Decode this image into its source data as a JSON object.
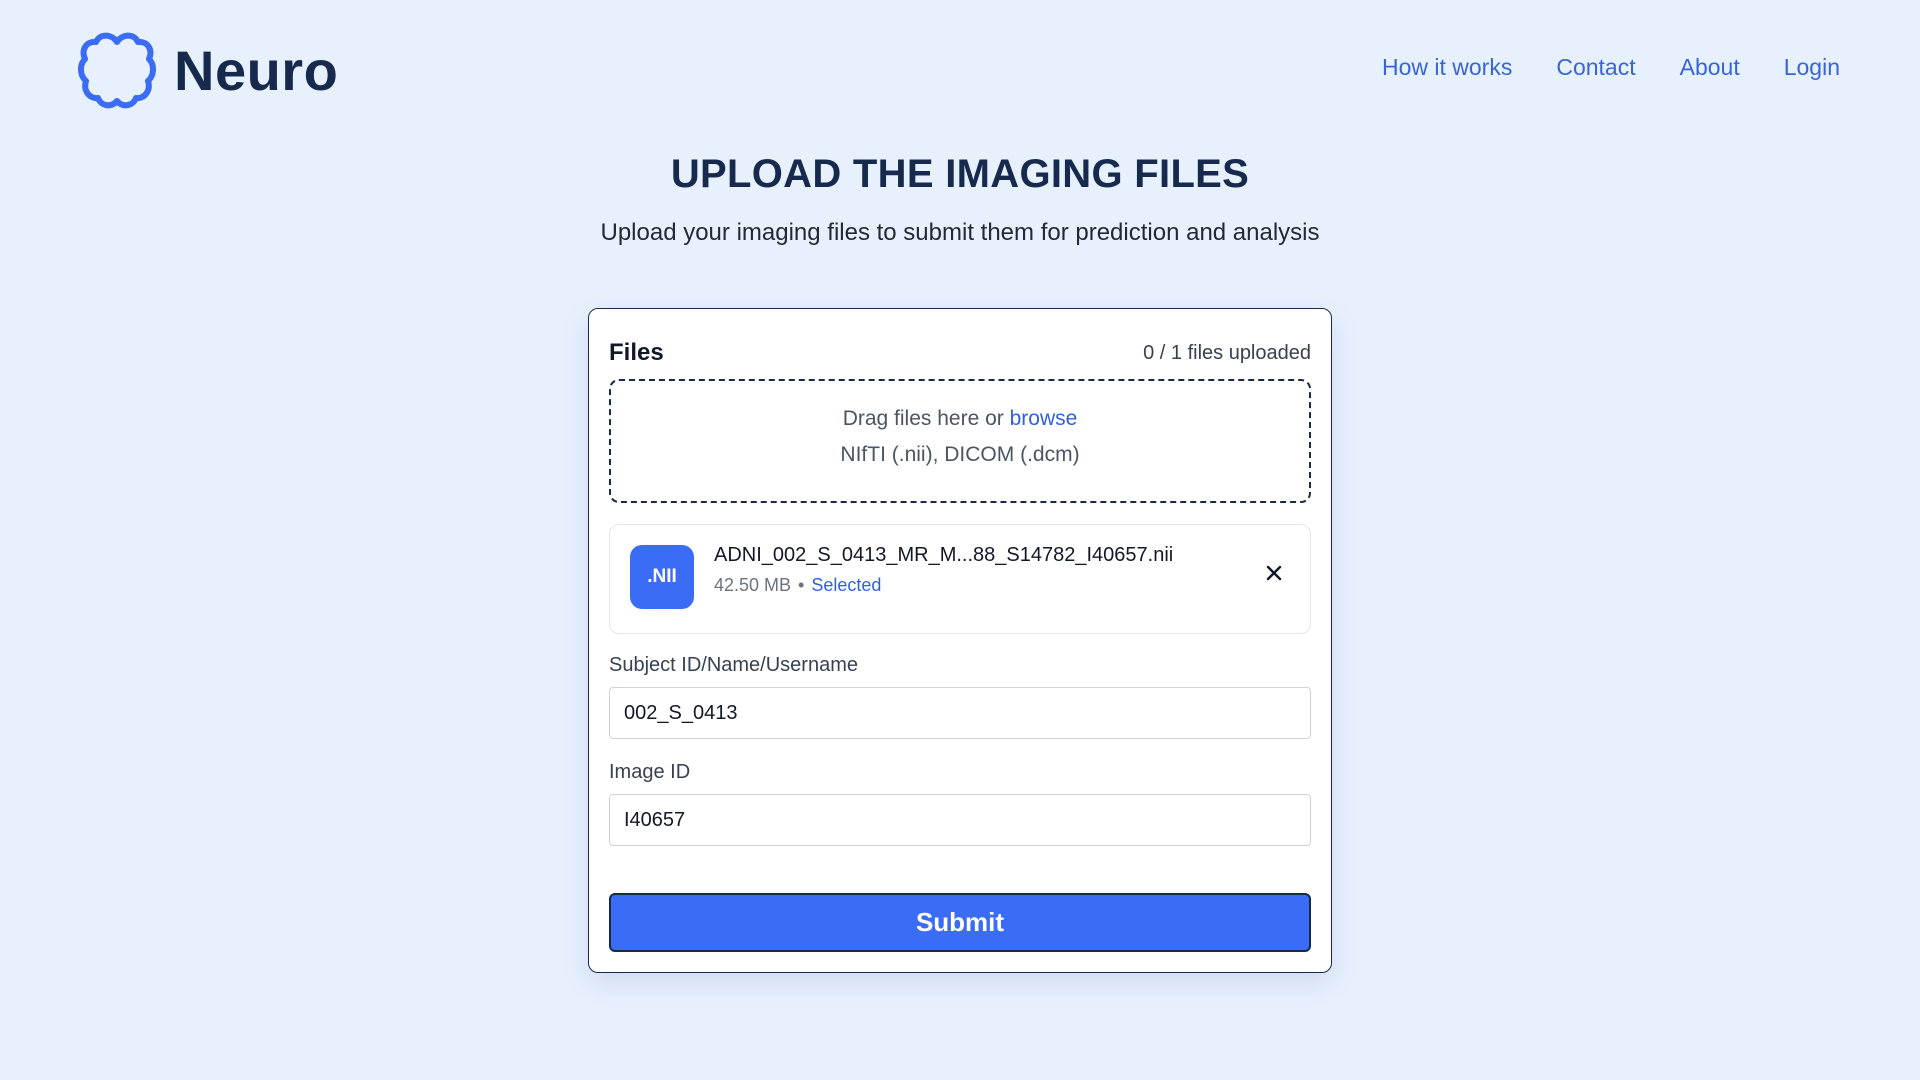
{
  "brand": {
    "name": "Neuro",
    "icon": "brain-icon"
  },
  "nav": {
    "items": [
      {
        "label": "How it works"
      },
      {
        "label": "Contact"
      },
      {
        "label": "About"
      },
      {
        "label": "Login"
      }
    ]
  },
  "page": {
    "title": "UPLOAD THE IMAGING FILES",
    "subtitle": "Upload your imaging files to submit them for prediction and analysis"
  },
  "upload": {
    "title": "Files",
    "count": "0 / 1 files uploaded",
    "dropzone": {
      "text": "Drag files here or ",
      "browse": "browse",
      "formats": "NIfTI (.nii), DICOM (.dcm)"
    },
    "file": {
      "badge": ".NII",
      "name": "ADNI_002_S_0413_MR_M...88_S14782_I40657.nii",
      "size": "42.50 MB",
      "separator": "•",
      "status": "Selected",
      "remove_icon": "close-icon"
    },
    "fields": {
      "subject_label": "Subject ID/Name/Username",
      "subject_value": "002_S_0413",
      "image_label": "Image ID",
      "image_value": "I40657"
    },
    "submit_label": "Submit"
  },
  "colors": {
    "background": "#e7f1fe",
    "primary": "#3b6cf6",
    "link": "#3a64d6",
    "heading": "#172a4e"
  }
}
